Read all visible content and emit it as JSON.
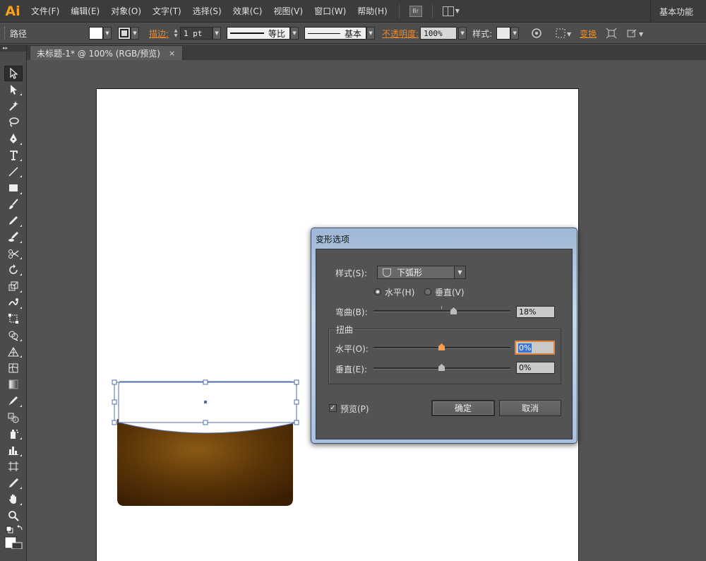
{
  "app": {
    "logo": "Ai",
    "menus": [
      "文件(F)",
      "编辑(E)",
      "对象(O)",
      "文字(T)",
      "选择(S)",
      "效果(C)",
      "视图(V)",
      "窗口(W)",
      "帮助(H)"
    ],
    "bridge_label": "Br",
    "workspace": "基本功能"
  },
  "control": {
    "selection_type": "路径",
    "stroke_label": "描边:",
    "stroke_weight": "1 pt",
    "profile": "等比",
    "brush": "基本",
    "opacity_label": "不透明度:",
    "opacity_value": "100%",
    "style_label": "样式:",
    "transform_label": "变换",
    "colors": {
      "accent_link": "#f08a24"
    }
  },
  "document": {
    "tab_title": "未标题-1* @ 100% (RGB/预览)",
    "close_glyph": "×"
  },
  "tools": [
    "selection-tool",
    "direct-selection-tool",
    "magic-wand-tool",
    "lasso-tool",
    "pen-tool",
    "type-tool",
    "line-tool",
    "rectangle-tool",
    "paintbrush-tool",
    "pencil-tool",
    "blob-brush-tool",
    "scissors-tool",
    "rotate-tool",
    "scale-tool",
    "warp-tool",
    "free-transform-tool",
    "shape-builder-tool",
    "perspective-grid-tool",
    "mesh-tool",
    "gradient-tool",
    "eyedropper-tool",
    "blend-tool",
    "symbol-sprayer-tool",
    "column-graph-tool",
    "artboard-tool",
    "slice-tool",
    "hand-tool",
    "zoom-tool",
    "fill-stroke-swap-icon"
  ],
  "dialog": {
    "title": "变形选项",
    "style_label": "样式(S):",
    "style_value": "下弧形",
    "horizontal_label": "水平(H)",
    "vertical_label": "垂直(V)",
    "orientation_selected": "horizontal",
    "bend_label": "弯曲(B):",
    "bend_value": "18%",
    "distortion_group": "扭曲",
    "dist_h_label": "水平(O):",
    "dist_h_value": "0%",
    "dist_v_label": "垂直(E):",
    "dist_v_value": "0%",
    "preview_label": "预览(P)",
    "preview_checked": true,
    "ok_label": "确定",
    "cancel_label": "取消"
  }
}
